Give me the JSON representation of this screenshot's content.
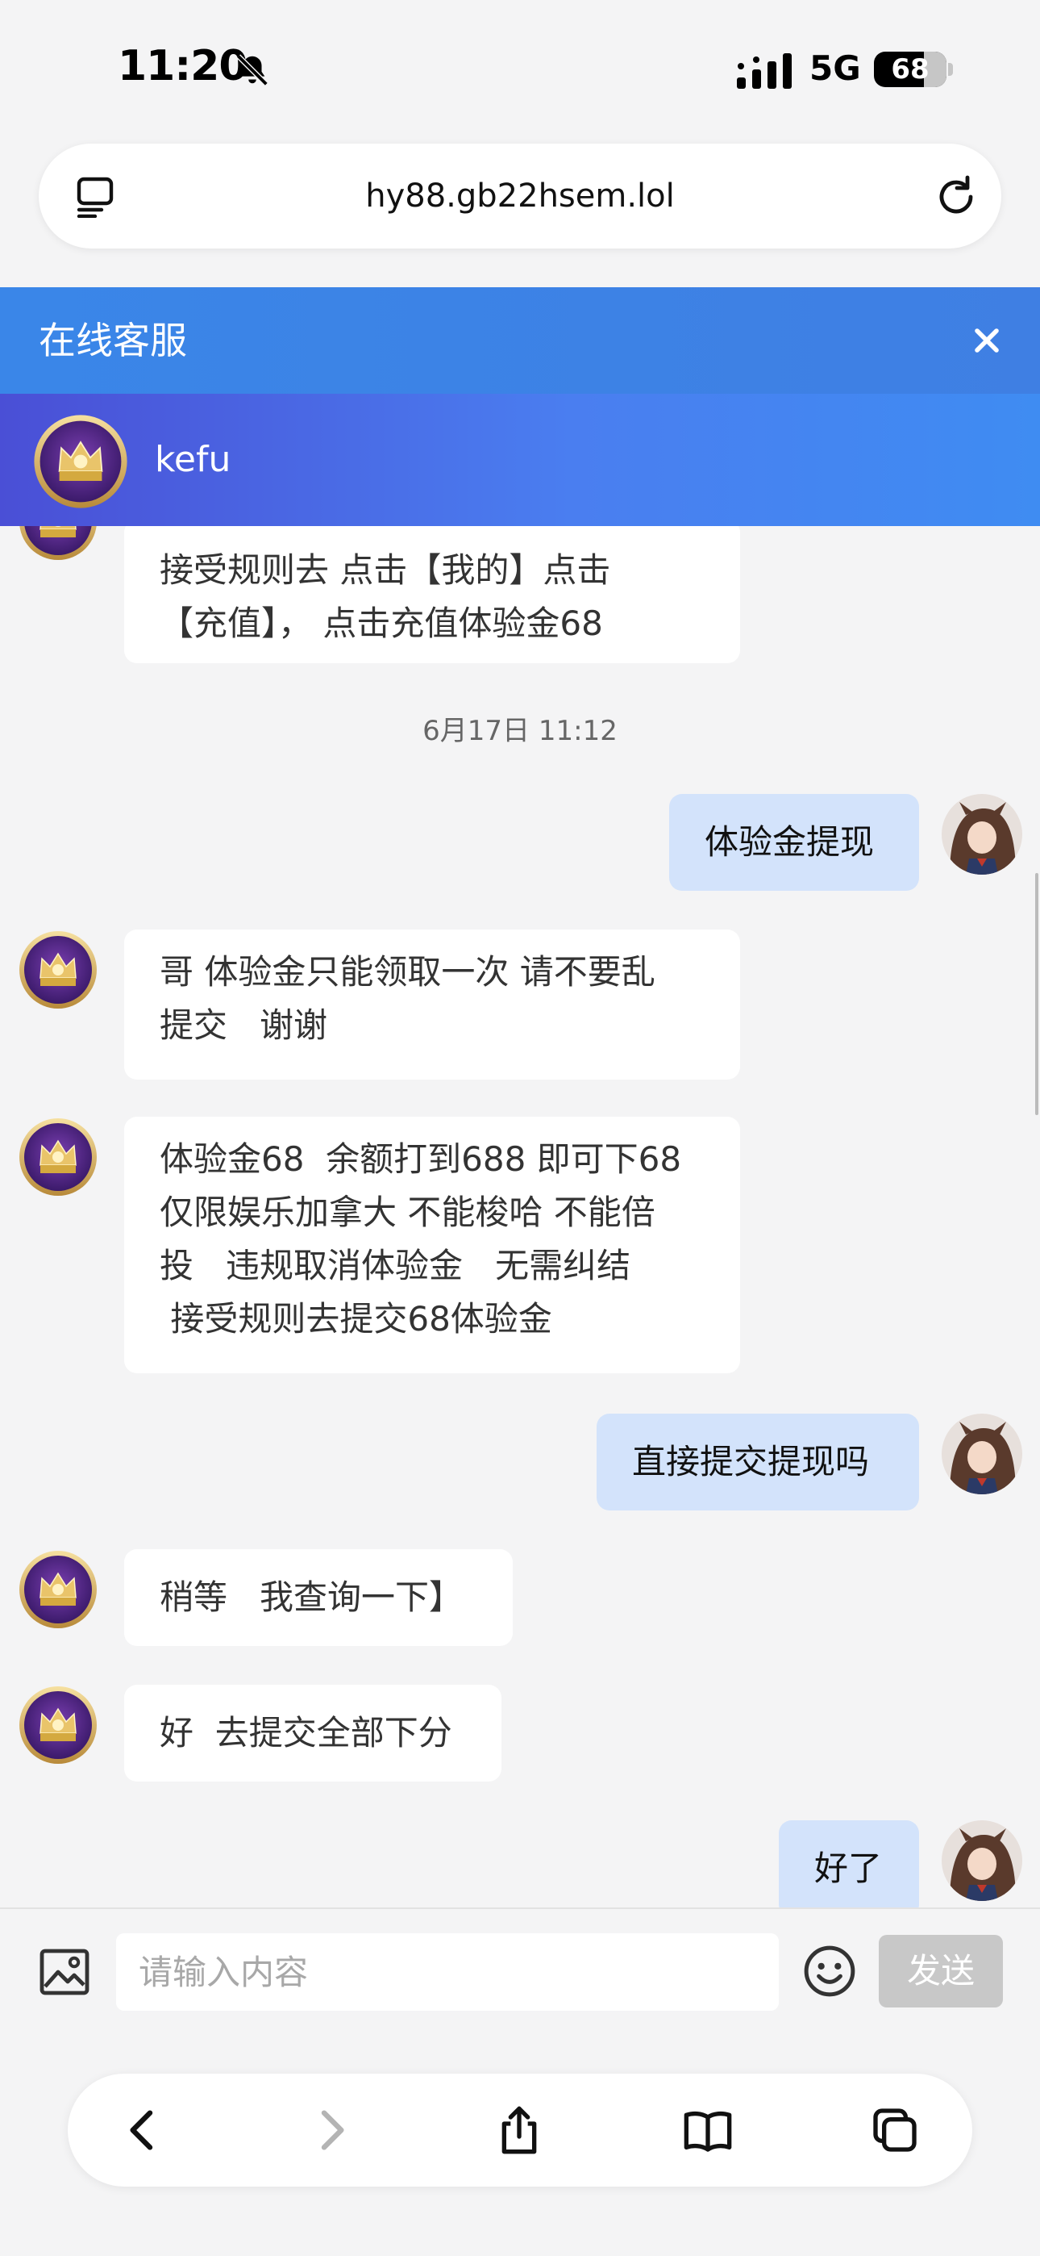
{
  "status_bar": {
    "time": "11:20",
    "network": "5G",
    "battery": "68"
  },
  "browser": {
    "url": "hy88.gb22hsem.lol"
  },
  "service": {
    "title": "在线客服",
    "agent_name": "kefu"
  },
  "chat": {
    "timestamp": "6月17日 11:12",
    "messages": [
      {
        "from": "agent",
        "text": "接受规则去 点击【我的】点击\n【充值】， 点击充值体验金68"
      },
      {
        "from": "user",
        "text": "体验金提现"
      },
      {
        "from": "agent",
        "text": "哥 体验金只能领取一次 请不要乱\n提交   谢谢"
      },
      {
        "from": "agent",
        "text": "体验金68  余额打到688 即可下68\n仅限娱乐加拿大 不能梭哈 不能倍\n投   违规取消体验金   无需纠结\n 接受规则去提交68体验金"
      },
      {
        "from": "user",
        "text": "直接提交提现吗"
      },
      {
        "from": "agent",
        "text": "稍等   我查询一下】"
      },
      {
        "from": "agent",
        "text": "好  去提交全部下分"
      },
      {
        "from": "user",
        "text": "好了"
      }
    ]
  },
  "input": {
    "placeholder": "请输入内容",
    "send_label": "发送"
  },
  "colors": {
    "header_blue": "#3a86e8",
    "user_bubble": "#d3e3fb",
    "send_disabled": "#c8c8c8"
  },
  "icons": [
    "bell-slash-icon",
    "signal-icon",
    "tabs-icon",
    "reload-icon",
    "close-icon",
    "image-icon",
    "emoji-icon",
    "back-icon",
    "forward-icon",
    "share-icon",
    "bookmarks-icon",
    "tabs-overview-icon"
  ]
}
